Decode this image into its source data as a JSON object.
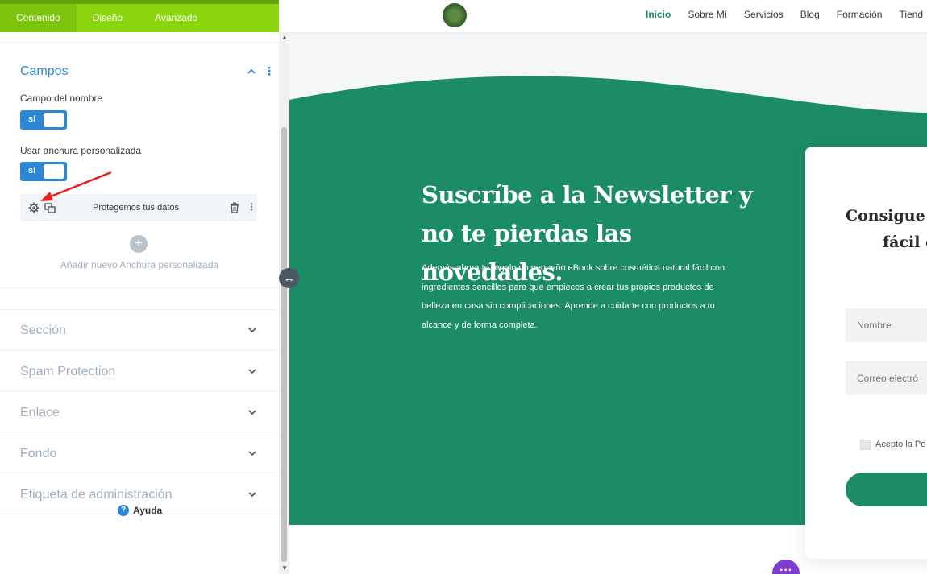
{
  "panel": {
    "tabs": [
      {
        "label": "Contenido",
        "active": true
      },
      {
        "label": "Diseño",
        "active": false
      },
      {
        "label": "Avanzado",
        "active": false
      }
    ],
    "campos": {
      "title": "Campos",
      "name_field_label": "Campo del nombre",
      "name_field_toggle": "sí",
      "custom_width_label": "Usar anchura personalizada",
      "custom_width_toggle": "sí",
      "item_label": "Protegemos tus datos",
      "add_label": "Añadir nuevo Anchura personalizada"
    },
    "accordions": [
      {
        "title": "Sección"
      },
      {
        "title": "Spam Protection"
      },
      {
        "title": "Enlace"
      },
      {
        "title": "Fondo"
      },
      {
        "title": "Etiqueta de administración"
      }
    ],
    "help_label": "Ayuda"
  },
  "preview": {
    "nav": [
      "Inicio",
      "Sobre Mí",
      "Servicios",
      "Blog",
      "Formación",
      "Tiend"
    ],
    "nav_active_index": 0,
    "headline_line1": "Suscríbe a la Newsletter y",
    "headline_line2": "no te pierdas las novedades.",
    "body_lines": [
      "Además ahora te regalo un pequeño eBook sobre cosmética natural fácil con",
      "ingredientes sencillos para que empieces a crear tus propios productos de",
      "belleza en casa sin complicaciones. Aprende a cuidarte con productos a tu",
      "alcance y de forma completa."
    ],
    "card": {
      "title_line1": "Consigue",
      "title_line2": "fácil c",
      "name_placeholder": "Nombre",
      "email_placeholder": "Correo electró",
      "consent_label": "Acepto la Po"
    },
    "float_button": "···"
  },
  "colors": {
    "panel_tab_bg": "#8bd60d",
    "accent_blue": "#2b87da",
    "brand_green": "#1c8c64",
    "float_purple": "#7e3bd0",
    "annotation_red": "#e8201c"
  }
}
